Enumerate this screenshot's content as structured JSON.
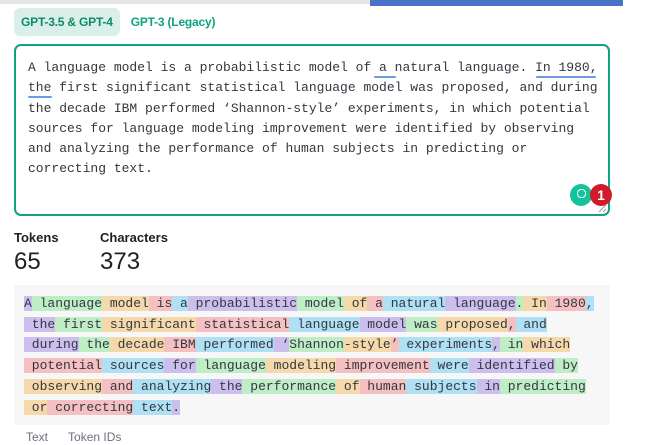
{
  "tabs": [
    {
      "label": "GPT-3.5 & GPT-4",
      "active": true
    },
    {
      "label": "GPT-3 (Legacy)",
      "active": false
    }
  ],
  "editor": {
    "lines": [
      "A language model is a probabilistic model of a natural language. In 1980,",
      "the first significant statistical language model was proposed, and during",
      "the decade IBM performed ‘Shannon-style’ experiments, in which potential",
      "sources for language modeling improvement were identified by observing",
      "and analyzing the performance of human subjects in predicting or",
      "correcting text."
    ],
    "issue_count": "1"
  },
  "stats": {
    "tokens_label": "Tokens",
    "tokens_value": "65",
    "characters_label": "Characters",
    "characters_value": "373"
  },
  "tokenized_lines": [
    [
      "A",
      " language",
      " model",
      " is",
      " a",
      " probabilistic",
      " model",
      " of",
      " a",
      " natural",
      " language",
      ".",
      " In",
      " 1980",
      ","
    ],
    [
      " the",
      " first",
      " significant",
      " statistical",
      " language",
      " model",
      " was",
      " proposed",
      ",",
      " and"
    ],
    [
      " during",
      " the",
      " decade",
      " IBM",
      " performed",
      " ‘",
      "Shannon",
      "-style",
      "’",
      " experiments",
      ",",
      " in",
      " which"
    ],
    [
      " potential",
      " sources",
      " for",
      " language",
      " modeling",
      " improvement",
      " were",
      " identified",
      " by"
    ],
    [
      " observing",
      " and",
      " analyzing",
      " the",
      " performance",
      " of",
      " human",
      " subjects",
      " in",
      " predicting"
    ],
    [
      " or",
      " correcting",
      " text",
      "."
    ]
  ],
  "token_colors": [
    "#6b40d8",
    "#68de7a",
    "#f4ac36",
    "#ef4146",
    "#27b5ea"
  ],
  "bottom_tabs": [
    "Text",
    "Token IDs"
  ]
}
